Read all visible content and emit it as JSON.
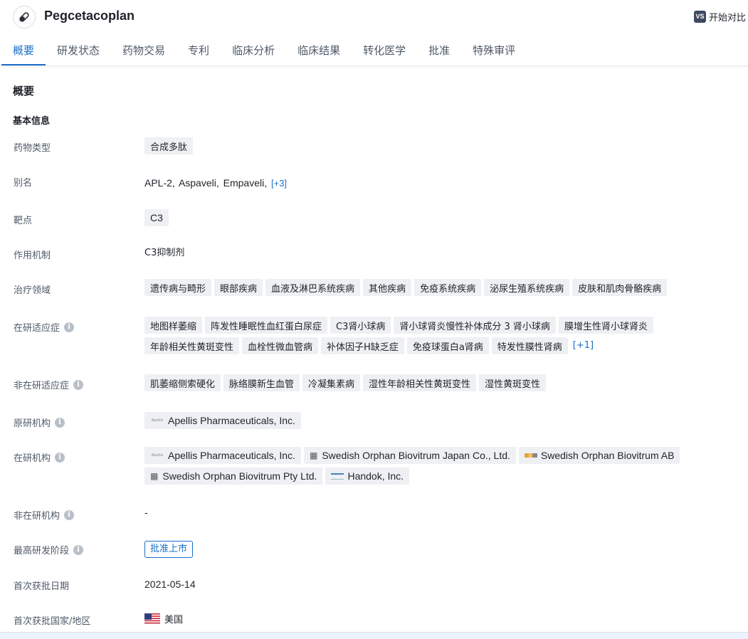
{
  "header": {
    "drug_name": "Pegcetacoplan",
    "compare_badge": "VS",
    "compare_label": "开始对比"
  },
  "tabs": [
    {
      "label": "概要",
      "active": true
    },
    {
      "label": "研发状态"
    },
    {
      "label": "药物交易"
    },
    {
      "label": "专利"
    },
    {
      "label": "临床分析"
    },
    {
      "label": "临床结果"
    },
    {
      "label": "转化医学"
    },
    {
      "label": "批准"
    },
    {
      "label": "特殊审评"
    }
  ],
  "section_title": "概要",
  "basic_info_title": "基本信息",
  "fields": {
    "drug_type": {
      "label": "药物类型",
      "tags": [
        "合成多肽"
      ]
    },
    "aliases": {
      "label": "别名",
      "values": [
        "APL-2,",
        "Aspaveli,",
        "Empaveli,"
      ],
      "more": "[+3]"
    },
    "target": {
      "label": "靶点",
      "tags": [
        "C3"
      ]
    },
    "mechanism": {
      "label": "作用机制",
      "value": "C3抑制剂"
    },
    "therapeutic_area": {
      "label": "治疗领域",
      "tags": [
        "遗传病与畸形",
        "眼部疾病",
        "血液及淋巴系统疾病",
        "其他疾病",
        "免疫系统疾病",
        "泌尿生殖系统疾病",
        "皮肤和肌肉骨骼疾病"
      ]
    },
    "active_indications": {
      "label": "在研适应症",
      "tags": [
        "地图样萎缩",
        "阵发性睡眠性血红蛋白尿症",
        "C3肾小球病",
        "肾小球肾炎慢性补体成分 3 肾小球病",
        "膜增生性肾小球肾炎",
        "年龄相关性黄斑变性",
        "血栓性微血管病",
        "补体因子H缺乏症",
        "免疫球蛋白a肾病",
        "特发性膜性肾病"
      ],
      "more": "[+1]"
    },
    "inactive_indications": {
      "label": "非在研适应症",
      "tags": [
        "肌萎缩侧索硬化",
        "脉络膜新生血管",
        "冷凝集素病",
        "湿性年龄相关性黄斑变性",
        "湿性黄斑变性"
      ]
    },
    "originator": {
      "label": "原研机构",
      "orgs": [
        {
          "name": "Apellis Pharmaceuticals, Inc.",
          "logo": "apellis-logo",
          "logo_text": "Apellis"
        }
      ]
    },
    "active_orgs": {
      "label": "在研机构",
      "orgs": [
        {
          "name": "Apellis Pharmaceuticals, Inc.",
          "logo": "apellis-logo",
          "logo_text": "Apellis"
        },
        {
          "name": "Swedish Orphan Biovitrum Japan Co., Ltd.",
          "logo": "building-icon"
        },
        {
          "name": "Swedish Orphan Biovitrum AB",
          "logo": "sobi-logo"
        },
        {
          "name": "Swedish Orphan Biovitrum Pty Ltd.",
          "logo": "building-icon"
        },
        {
          "name": "Handok, Inc.",
          "logo": "handok-logo"
        }
      ]
    },
    "inactive_orgs": {
      "label": "非在研机构",
      "value": "-"
    },
    "highest_phase": {
      "label": "最高研发阶段",
      "value": "批准上市"
    },
    "first_approval_date": {
      "label": "首次获批日期",
      "value": "2021-05-14"
    },
    "first_approval_country": {
      "label": "首次获批国家/地区",
      "value": "美国",
      "flag": "us-flag-icon"
    }
  },
  "colors": {
    "accent": "#1a6fc9",
    "tag_bg": "#eef0f3",
    "label": "#4e5969"
  }
}
